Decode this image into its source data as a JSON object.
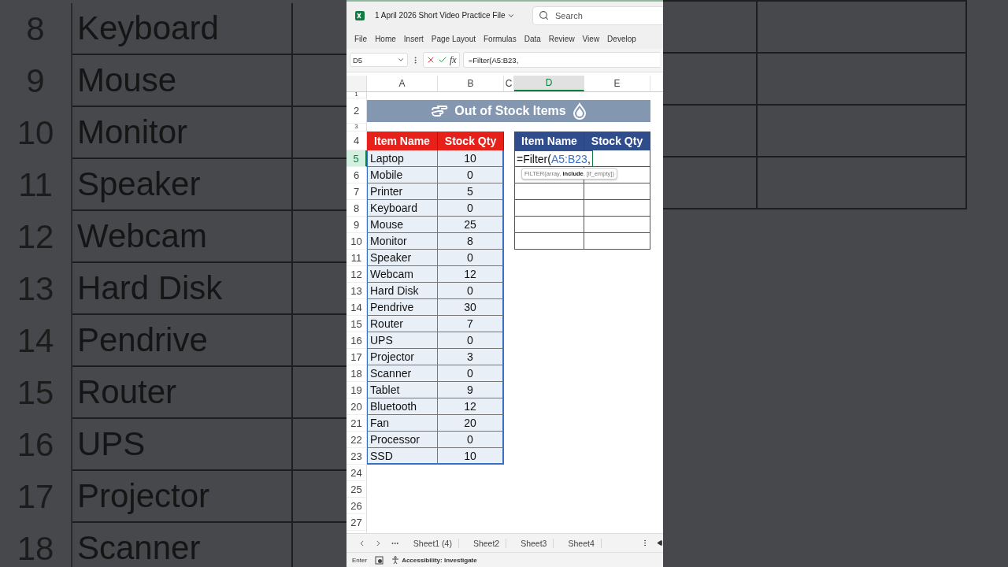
{
  "backdrop": {
    "rows": [
      {
        "number": "8",
        "name": "Keyboard"
      },
      {
        "number": "9",
        "name": "Mouse"
      },
      {
        "number": "10",
        "name": "Monitor"
      },
      {
        "number": "11",
        "name": "Speaker"
      },
      {
        "number": "12",
        "name": "Webcam"
      },
      {
        "number": "13",
        "name": "Hard Disk"
      },
      {
        "number": "14",
        "name": "Pendrive"
      },
      {
        "number": "15",
        "name": "Router"
      },
      {
        "number": "16",
        "name": "UPS"
      },
      {
        "number": "17",
        "name": "Projector"
      },
      {
        "number": "18",
        "name": "Scanner"
      }
    ]
  },
  "window": {
    "title": "1 April 2026 Short Video Practice File",
    "search": {
      "placeholder": "Search"
    }
  },
  "ribbon_tabs": [
    "File",
    "Home",
    "Insert",
    "Page Layout",
    "Formulas",
    "Data",
    "Review",
    "View",
    "Develop"
  ],
  "formula_bar": {
    "name_box": "D5",
    "function_label": "fx",
    "formula": "=Filter(A5:B23,"
  },
  "columns": [
    {
      "label": "A",
      "selected": false
    },
    {
      "label": "B",
      "selected": false
    },
    {
      "label": "C",
      "selected": false
    },
    {
      "label": "D",
      "selected": true
    },
    {
      "label": "E",
      "selected": false
    }
  ],
  "row_headers": [
    {
      "label": "1",
      "selected": false
    },
    {
      "label": "2",
      "selected": false
    },
    {
      "label": "3",
      "selected": false
    },
    {
      "label": "4",
      "selected": false
    },
    {
      "label": "5",
      "selected": true
    },
    {
      "label": "6",
      "selected": false
    },
    {
      "label": "7",
      "selected": false
    },
    {
      "label": "8",
      "selected": false
    },
    {
      "label": "9",
      "selected": false
    },
    {
      "label": "10",
      "selected": false
    },
    {
      "label": "11",
      "selected": false
    },
    {
      "label": "12",
      "selected": false
    },
    {
      "label": "13",
      "selected": false
    },
    {
      "label": "14",
      "selected": false
    },
    {
      "label": "15",
      "selected": false
    },
    {
      "label": "16",
      "selected": false
    },
    {
      "label": "17",
      "selected": false
    },
    {
      "label": "18",
      "selected": false
    },
    {
      "label": "19",
      "selected": false
    },
    {
      "label": "20",
      "selected": false
    },
    {
      "label": "21",
      "selected": false
    },
    {
      "label": "22",
      "selected": false
    },
    {
      "label": "23",
      "selected": false
    },
    {
      "label": "24",
      "selected": false
    },
    {
      "label": "25",
      "selected": false
    },
    {
      "label": "26",
      "selected": false
    },
    {
      "label": "27",
      "selected": false
    }
  ],
  "banner": {
    "title": "Out of Stock Items"
  },
  "source_table": {
    "columns": [
      "Item Name",
      "Stock Qty"
    ],
    "rows": [
      {
        "item": "Laptop",
        "qty": "10"
      },
      {
        "item": "Mobile",
        "qty": "0"
      },
      {
        "item": "Printer",
        "qty": "5"
      },
      {
        "item": "Keyboard",
        "qty": "0"
      },
      {
        "item": "Mouse",
        "qty": "25"
      },
      {
        "item": "Monitor",
        "qty": "8"
      },
      {
        "item": "Speaker",
        "qty": "0"
      },
      {
        "item": "Webcam",
        "qty": "12"
      },
      {
        "item": "Hard Disk",
        "qty": "0"
      },
      {
        "item": "Pendrive",
        "qty": "30"
      },
      {
        "item": "Router",
        "qty": "7"
      },
      {
        "item": "UPS",
        "qty": "0"
      },
      {
        "item": "Projector",
        "qty": "3"
      },
      {
        "item": "Scanner",
        "qty": "0"
      },
      {
        "item": "Tablet",
        "qty": "9"
      },
      {
        "item": "Bluetooth",
        "qty": "12"
      },
      {
        "item": "Fan",
        "qty": "20"
      },
      {
        "item": "Processor",
        "qty": "0"
      },
      {
        "item": "SSD",
        "qty": "10"
      }
    ]
  },
  "result_table": {
    "columns": [
      "Item Name",
      "Stock Qty"
    ],
    "editing_cell": {
      "prefix": "=Filter(",
      "reference": "A5:B23",
      "suffix": ","
    },
    "tooltip": "FILTER(array, **include**, [if_empty])"
  },
  "sheet_tabs": [
    "Sheet1 (4)",
    "Sheet2",
    "Sheet3",
    "Sheet4"
  ],
  "status_bar": {
    "mode": "Enter",
    "accessibility": "Accessibility: Investigate"
  }
}
